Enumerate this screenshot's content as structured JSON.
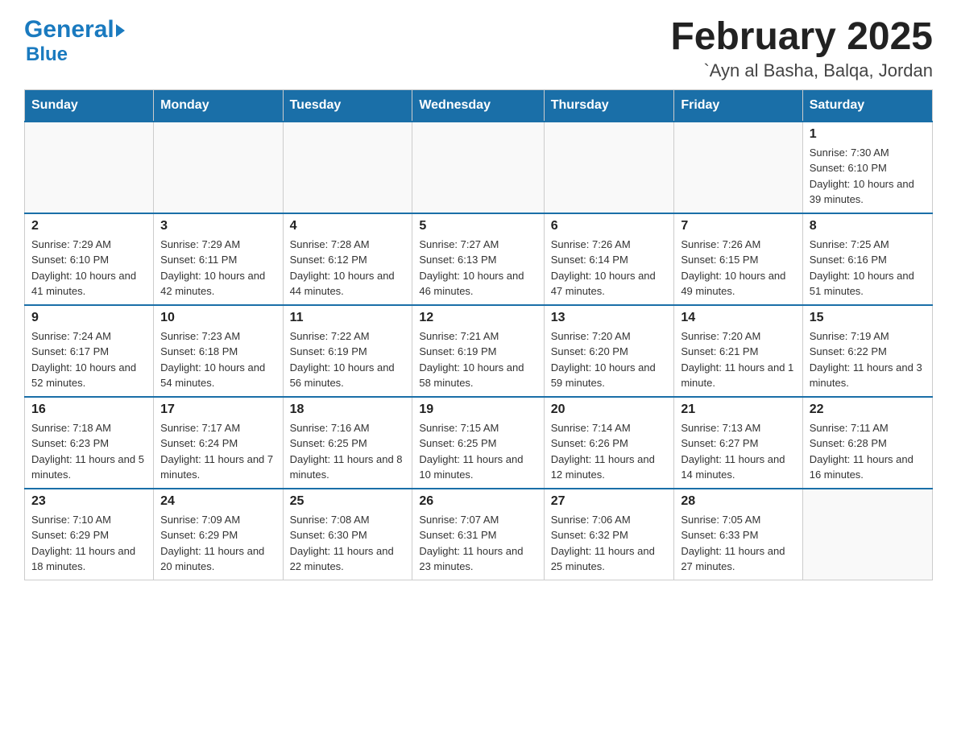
{
  "header": {
    "logo_general": "General",
    "logo_blue": "Blue",
    "month_year": "February 2025",
    "location": "`Ayn al Basha, Balqa, Jordan"
  },
  "days_of_week": [
    "Sunday",
    "Monday",
    "Tuesday",
    "Wednesday",
    "Thursday",
    "Friday",
    "Saturday"
  ],
  "weeks": [
    [
      {
        "day": "",
        "info": ""
      },
      {
        "day": "",
        "info": ""
      },
      {
        "day": "",
        "info": ""
      },
      {
        "day": "",
        "info": ""
      },
      {
        "day": "",
        "info": ""
      },
      {
        "day": "",
        "info": ""
      },
      {
        "day": "1",
        "info": "Sunrise: 7:30 AM\nSunset: 6:10 PM\nDaylight: 10 hours and 39 minutes."
      }
    ],
    [
      {
        "day": "2",
        "info": "Sunrise: 7:29 AM\nSunset: 6:10 PM\nDaylight: 10 hours and 41 minutes."
      },
      {
        "day": "3",
        "info": "Sunrise: 7:29 AM\nSunset: 6:11 PM\nDaylight: 10 hours and 42 minutes."
      },
      {
        "day": "4",
        "info": "Sunrise: 7:28 AM\nSunset: 6:12 PM\nDaylight: 10 hours and 44 minutes."
      },
      {
        "day": "5",
        "info": "Sunrise: 7:27 AM\nSunset: 6:13 PM\nDaylight: 10 hours and 46 minutes."
      },
      {
        "day": "6",
        "info": "Sunrise: 7:26 AM\nSunset: 6:14 PM\nDaylight: 10 hours and 47 minutes."
      },
      {
        "day": "7",
        "info": "Sunrise: 7:26 AM\nSunset: 6:15 PM\nDaylight: 10 hours and 49 minutes."
      },
      {
        "day": "8",
        "info": "Sunrise: 7:25 AM\nSunset: 6:16 PM\nDaylight: 10 hours and 51 minutes."
      }
    ],
    [
      {
        "day": "9",
        "info": "Sunrise: 7:24 AM\nSunset: 6:17 PM\nDaylight: 10 hours and 52 minutes."
      },
      {
        "day": "10",
        "info": "Sunrise: 7:23 AM\nSunset: 6:18 PM\nDaylight: 10 hours and 54 minutes."
      },
      {
        "day": "11",
        "info": "Sunrise: 7:22 AM\nSunset: 6:19 PM\nDaylight: 10 hours and 56 minutes."
      },
      {
        "day": "12",
        "info": "Sunrise: 7:21 AM\nSunset: 6:19 PM\nDaylight: 10 hours and 58 minutes."
      },
      {
        "day": "13",
        "info": "Sunrise: 7:20 AM\nSunset: 6:20 PM\nDaylight: 10 hours and 59 minutes."
      },
      {
        "day": "14",
        "info": "Sunrise: 7:20 AM\nSunset: 6:21 PM\nDaylight: 11 hours and 1 minute."
      },
      {
        "day": "15",
        "info": "Sunrise: 7:19 AM\nSunset: 6:22 PM\nDaylight: 11 hours and 3 minutes."
      }
    ],
    [
      {
        "day": "16",
        "info": "Sunrise: 7:18 AM\nSunset: 6:23 PM\nDaylight: 11 hours and 5 minutes."
      },
      {
        "day": "17",
        "info": "Sunrise: 7:17 AM\nSunset: 6:24 PM\nDaylight: 11 hours and 7 minutes."
      },
      {
        "day": "18",
        "info": "Sunrise: 7:16 AM\nSunset: 6:25 PM\nDaylight: 11 hours and 8 minutes."
      },
      {
        "day": "19",
        "info": "Sunrise: 7:15 AM\nSunset: 6:25 PM\nDaylight: 11 hours and 10 minutes."
      },
      {
        "day": "20",
        "info": "Sunrise: 7:14 AM\nSunset: 6:26 PM\nDaylight: 11 hours and 12 minutes."
      },
      {
        "day": "21",
        "info": "Sunrise: 7:13 AM\nSunset: 6:27 PM\nDaylight: 11 hours and 14 minutes."
      },
      {
        "day": "22",
        "info": "Sunrise: 7:11 AM\nSunset: 6:28 PM\nDaylight: 11 hours and 16 minutes."
      }
    ],
    [
      {
        "day": "23",
        "info": "Sunrise: 7:10 AM\nSunset: 6:29 PM\nDaylight: 11 hours and 18 minutes."
      },
      {
        "day": "24",
        "info": "Sunrise: 7:09 AM\nSunset: 6:29 PM\nDaylight: 11 hours and 20 minutes."
      },
      {
        "day": "25",
        "info": "Sunrise: 7:08 AM\nSunset: 6:30 PM\nDaylight: 11 hours and 22 minutes."
      },
      {
        "day": "26",
        "info": "Sunrise: 7:07 AM\nSunset: 6:31 PM\nDaylight: 11 hours and 23 minutes."
      },
      {
        "day": "27",
        "info": "Sunrise: 7:06 AM\nSunset: 6:32 PM\nDaylight: 11 hours and 25 minutes."
      },
      {
        "day": "28",
        "info": "Sunrise: 7:05 AM\nSunset: 6:33 PM\nDaylight: 11 hours and 27 minutes."
      },
      {
        "day": "",
        "info": ""
      }
    ]
  ]
}
